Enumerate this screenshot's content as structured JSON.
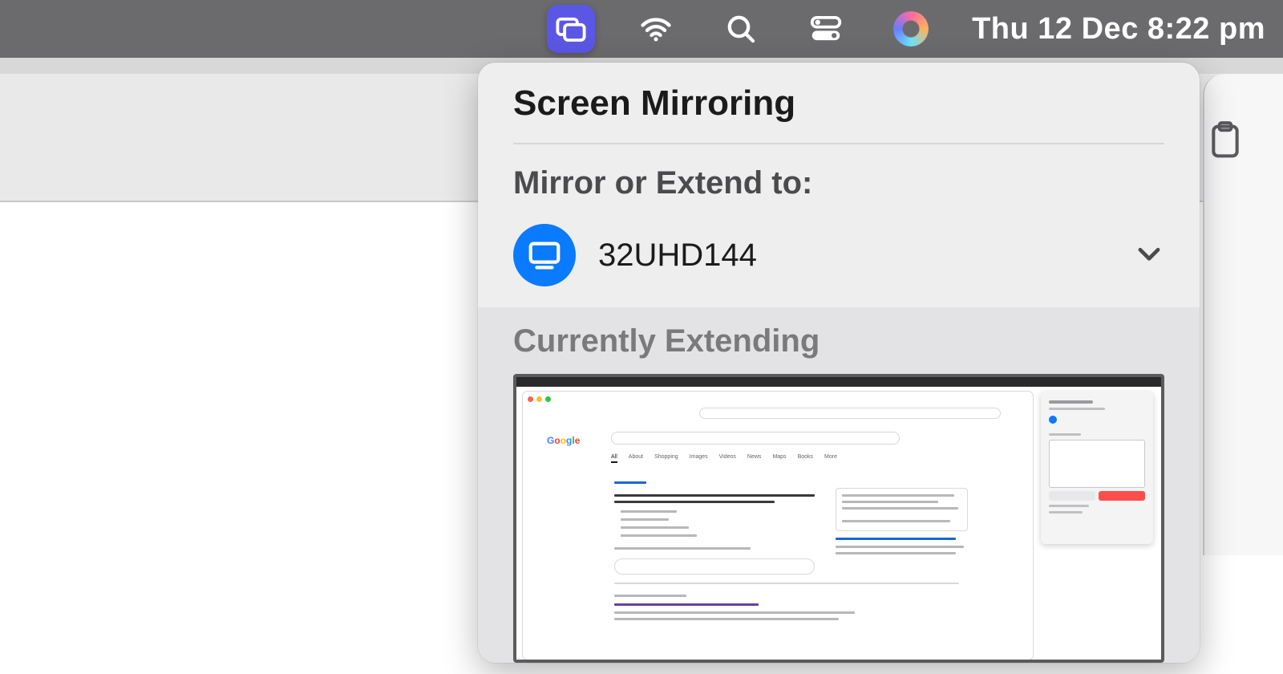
{
  "menubar": {
    "datetime": "Thu 12 Dec  8:22 pm"
  },
  "panel": {
    "title": "Screen Mirroring",
    "mirror_extend_label": "Mirror or Extend to:",
    "device": {
      "name": "32UHD144"
    },
    "currently_label": "Currently Extending"
  }
}
